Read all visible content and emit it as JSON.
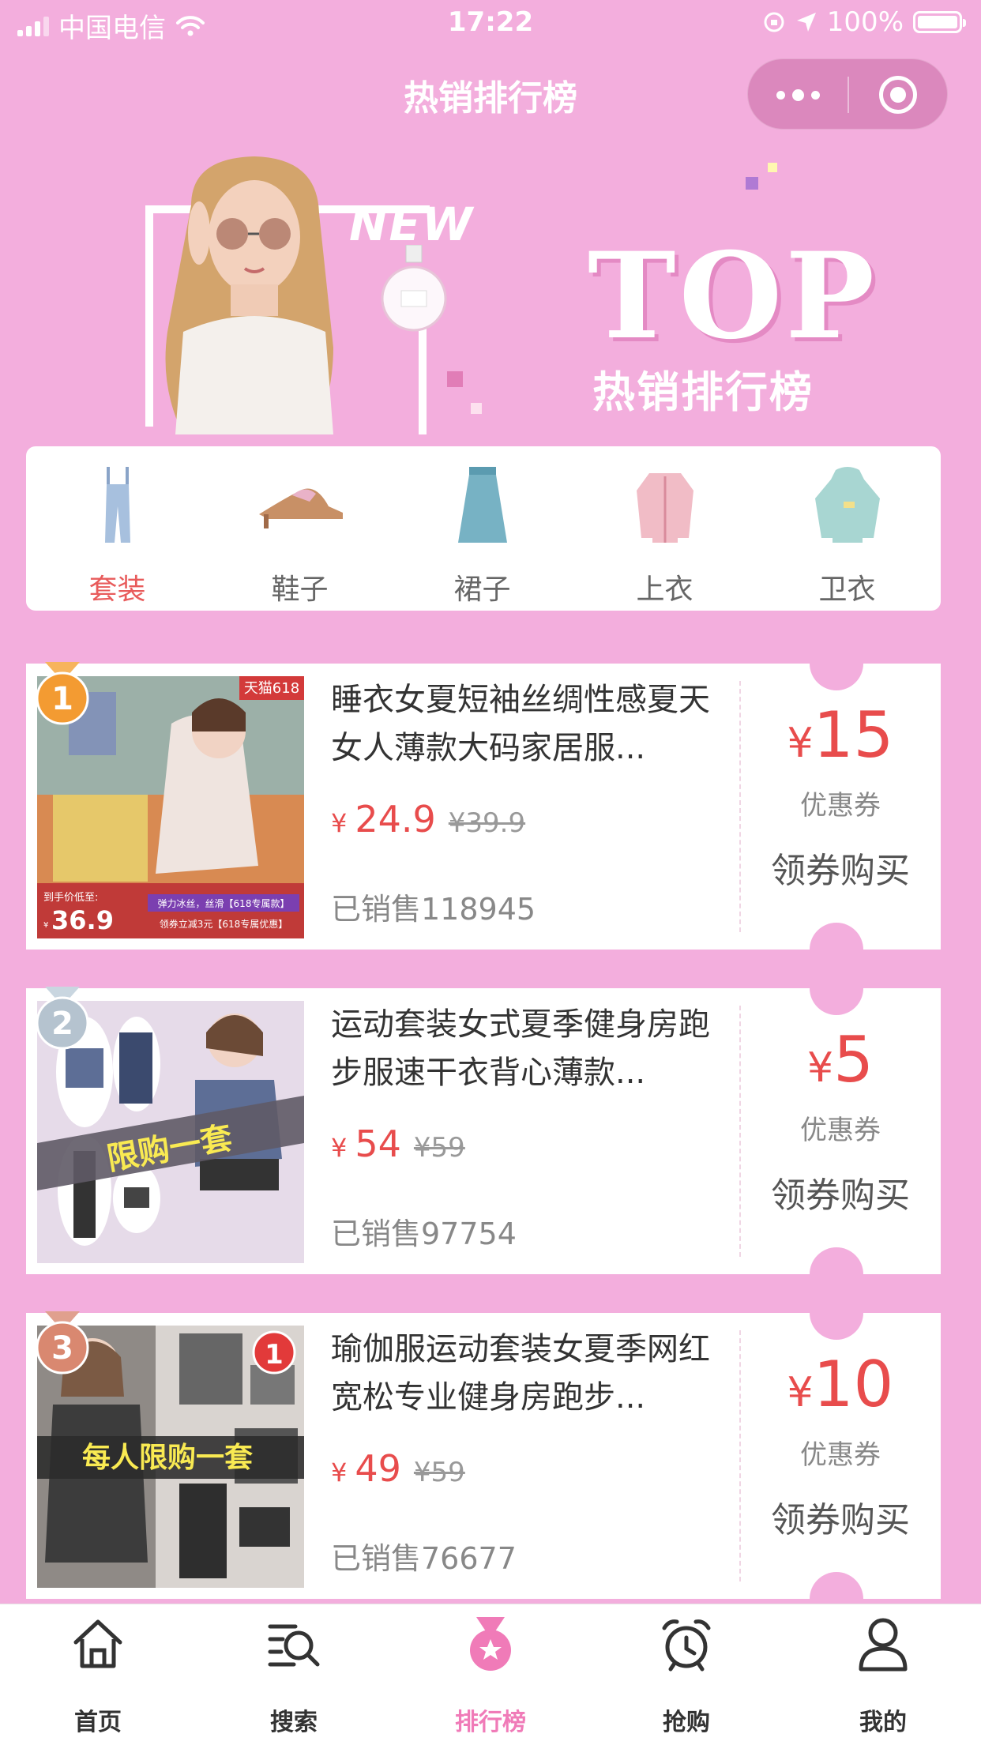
{
  "status_bar": {
    "carrier": "中国电信",
    "time": "17:22",
    "battery": "100%"
  },
  "nav": {
    "title": "热销排行榜"
  },
  "banner": {
    "new_text": "NEW",
    "top_text": "TOP",
    "subtitle": "热销排行榜"
  },
  "categories": [
    {
      "label": "套装",
      "icon": "overalls-icon",
      "active": true
    },
    {
      "label": "鞋子",
      "icon": "shoe-icon",
      "active": false
    },
    {
      "label": "裙子",
      "icon": "skirt-icon",
      "active": false
    },
    {
      "label": "上衣",
      "icon": "jacket-icon",
      "active": false
    },
    {
      "label": "卫衣",
      "icon": "hoodie-icon",
      "active": false
    }
  ],
  "products": [
    {
      "rank": "1",
      "name": "睡衣女夏短袖丝绸性感夏天女人薄款大码家居服...",
      "price": "24.9",
      "original_price": "¥39.9",
      "sold": "已销售118945",
      "coupon_value": "15",
      "coupon_label": "优惠券",
      "buy_label": "领券购买",
      "image_text": {
        "badge": "天猫618",
        "price_caption": "到手价低至:",
        "price": "36.9",
        "tag1": "弹力冰丝，丝滑【618专属款】",
        "tag2": "领券立减3元【618专属优惠】"
      }
    },
    {
      "rank": "2",
      "name": "运动套装女式夏季健身房跑步服速干衣背心薄款...",
      "price": "54",
      "original_price": "¥59",
      "sold": "已销售97754",
      "coupon_value": "5",
      "coupon_label": "优惠券",
      "buy_label": "领券购买",
      "image_text": {
        "banner": "限购一套"
      }
    },
    {
      "rank": "3",
      "name": "瑜伽服运动套装女夏季网红宽松专业健身房跑步...",
      "price": "49",
      "original_price": "¥59",
      "sold": "已销售76677",
      "coupon_value": "10",
      "coupon_label": "优惠券",
      "buy_label": "领券购买",
      "image_text": {
        "banner": "每人限购一套",
        "badge": "1"
      }
    }
  ],
  "currency": "¥",
  "tabbar": [
    {
      "label": "首页",
      "icon": "home-icon",
      "active": false
    },
    {
      "label": "搜索",
      "icon": "search-icon",
      "active": false
    },
    {
      "label": "排行榜",
      "icon": "ranking-medal-icon",
      "active": true
    },
    {
      "label": "抢购",
      "icon": "alarm-clock-icon",
      "active": false
    },
    {
      "label": "我的",
      "icon": "user-icon",
      "active": false
    }
  ],
  "colors": {
    "background": "#f3aedd",
    "accent": "#e84c4c",
    "tab_active": "#f07bb8"
  }
}
